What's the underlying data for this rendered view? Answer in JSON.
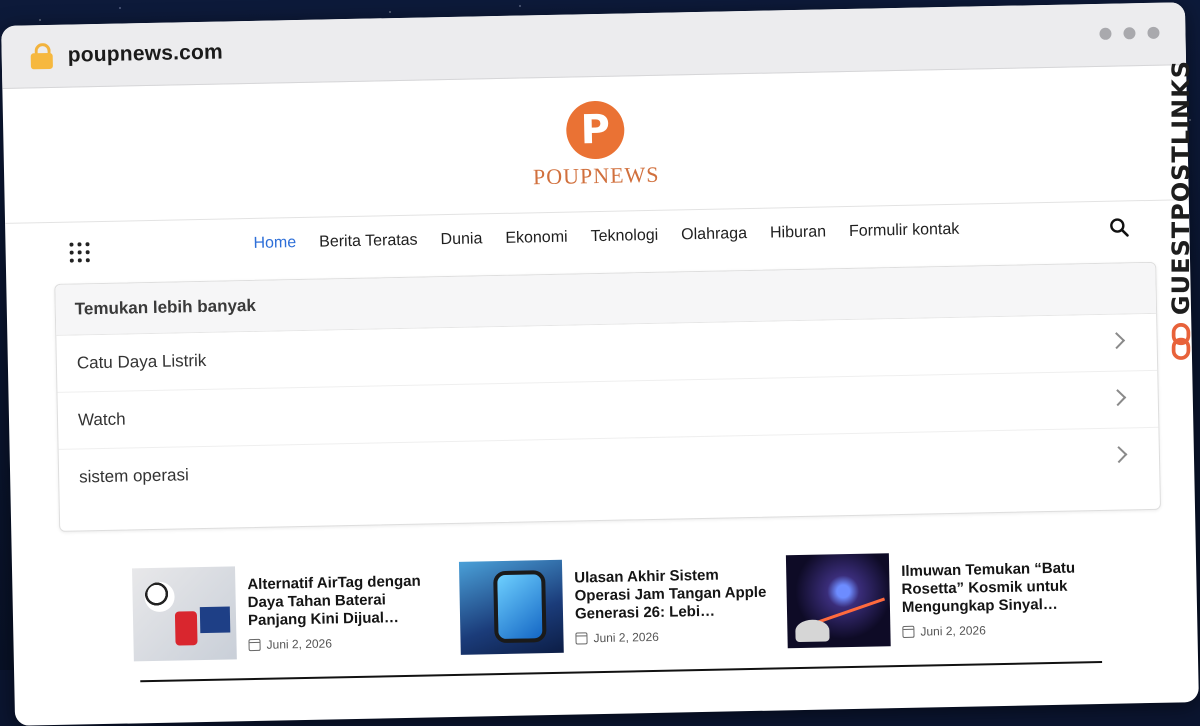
{
  "browser": {
    "url": "poupnews.com"
  },
  "site": {
    "logo_letter": "P",
    "logo_text": "POUPNEWS",
    "accent": "#ea7234",
    "link_active": "#2e6fd8"
  },
  "nav": {
    "items": [
      {
        "label": "Home",
        "active": true
      },
      {
        "label": "Berita Teratas"
      },
      {
        "label": "Dunia"
      },
      {
        "label": "Ekonomi"
      },
      {
        "label": "Teknologi"
      },
      {
        "label": "Olahraga"
      },
      {
        "label": "Hiburan"
      },
      {
        "label": "Formulir kontak"
      }
    ],
    "menu_icon": "grid-icon",
    "search_icon": "search-icon"
  },
  "discover": {
    "title": "Temukan lebih banyak",
    "items": [
      {
        "label": "Catu Daya Listrik"
      },
      {
        "label": "Watch"
      },
      {
        "label": "sistem operasi"
      }
    ]
  },
  "articles": [
    {
      "title": "Alternatif AirTag dengan Daya Tahan Baterai Panjang Kini Dijual Lebih…",
      "date": "Juni 2, 2026"
    },
    {
      "title": "Ulasan Akhir Sistem Operasi Jam Tangan Apple Generasi 26: Lebi…",
      "date": "Juni 2, 2026"
    },
    {
      "title": "Ilmuwan Temukan “Batu Rosetta” Kosmik untuk Mengungkap Sinyal…",
      "date": "Juni 2, 2026"
    }
  ],
  "watermark": {
    "text": "GUESTPOSTLINKS"
  }
}
